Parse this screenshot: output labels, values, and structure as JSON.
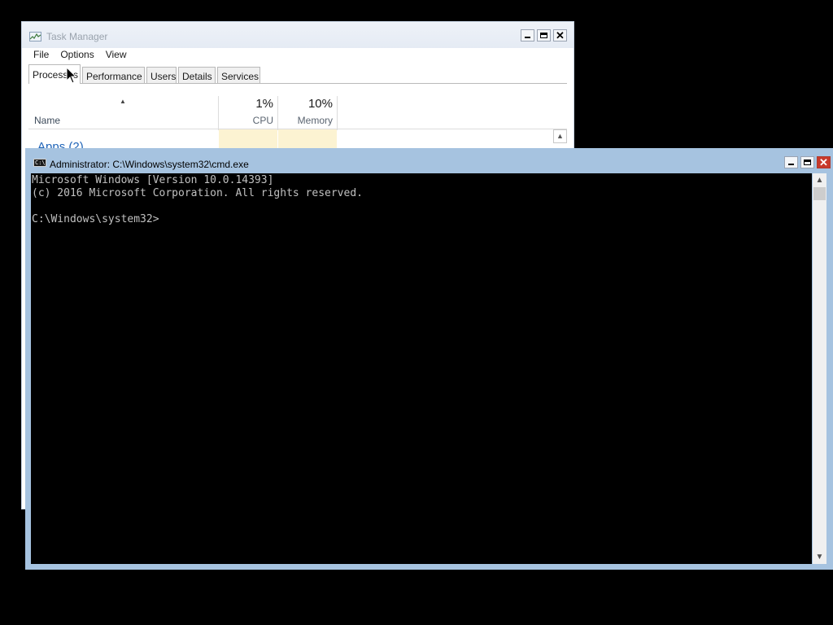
{
  "task_manager": {
    "title": "Task Manager",
    "menu": [
      "File",
      "Options",
      "View"
    ],
    "tabs": [
      "Processes",
      "Performance",
      "Users",
      "Details",
      "Services"
    ],
    "active_tab": "Processes",
    "columns": {
      "name": "Name",
      "cpu": {
        "percent": "1%",
        "label": "CPU"
      },
      "memory": {
        "percent": "10%",
        "label": "Memory"
      }
    },
    "apps_group": "Apps (2)",
    "colors": {
      "group_text": "#1f64b8",
      "highlight_cell": "#fcf3d2"
    }
  },
  "cmd": {
    "title": "Administrator: C:\\Windows\\system32\\cmd.exe",
    "icon_text": "C:\\",
    "console_text": "Microsoft Windows [Version 10.0.14393]\n(c) 2016 Microsoft Corporation. All rights reserved.\n\nC:\\Windows\\system32>",
    "colors": {
      "frame": "#a6c3e0",
      "close_button": "#c8392b",
      "console_bg": "#000000",
      "console_fg": "#c0c0c0"
    }
  },
  "icons": {
    "task_manager_app": "task-manager-icon",
    "cmd_app": "cmd-icon",
    "minimize": "minimize-icon",
    "maximize": "maximize-icon",
    "close": "close-icon",
    "sort": "sort-up-arrow-icon",
    "cursor": "mouse-cursor-icon"
  }
}
